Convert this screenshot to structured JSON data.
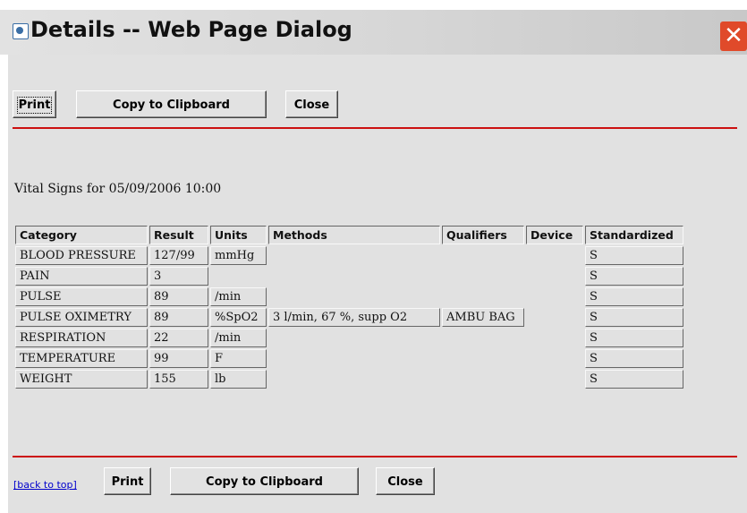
{
  "window": {
    "title": "Details -- Web Page Dialog"
  },
  "toolbar_top": {
    "print": "Print",
    "copy": "Copy to Clipboard",
    "close": "Close"
  },
  "toolbar_bottom": {
    "back_to_top": "[back to top]",
    "print": "Print",
    "copy": "Copy to Clipboard",
    "close": "Close"
  },
  "heading": "Vital Signs for 05/09/2006 10:00",
  "table": {
    "columns": [
      "Category",
      "Result",
      "Units",
      "Methods",
      "Qualifiers",
      "Device",
      "Standardized"
    ],
    "rows": [
      [
        "BLOOD PRESSURE",
        "127/99",
        "mmHg",
        "",
        "",
        "",
        "S"
      ],
      [
        "PAIN",
        "3",
        "",
        "",
        "",
        "",
        "S"
      ],
      [
        "PULSE",
        "89",
        "/min",
        "",
        "",
        "",
        "S"
      ],
      [
        "PULSE OXIMETRY",
        "89",
        "%SpO2",
        "3 l/min, 67 %, supp O2",
        "AMBU BAG",
        "",
        "S"
      ],
      [
        "RESPIRATION",
        "22",
        "/min",
        "",
        "",
        "",
        "S"
      ],
      [
        "TEMPERATURE",
        "99",
        "F",
        "",
        "",
        "",
        "S"
      ],
      [
        "WEIGHT",
        "155",
        "lb",
        "",
        "",
        "",
        "S"
      ]
    ]
  },
  "colors": {
    "accent_line": "#cc1010",
    "dialog_bg": "#e1e1e1",
    "link": "#0000cc"
  },
  "icons": {
    "title": "ie-page-icon",
    "close": "close-x-icon"
  }
}
